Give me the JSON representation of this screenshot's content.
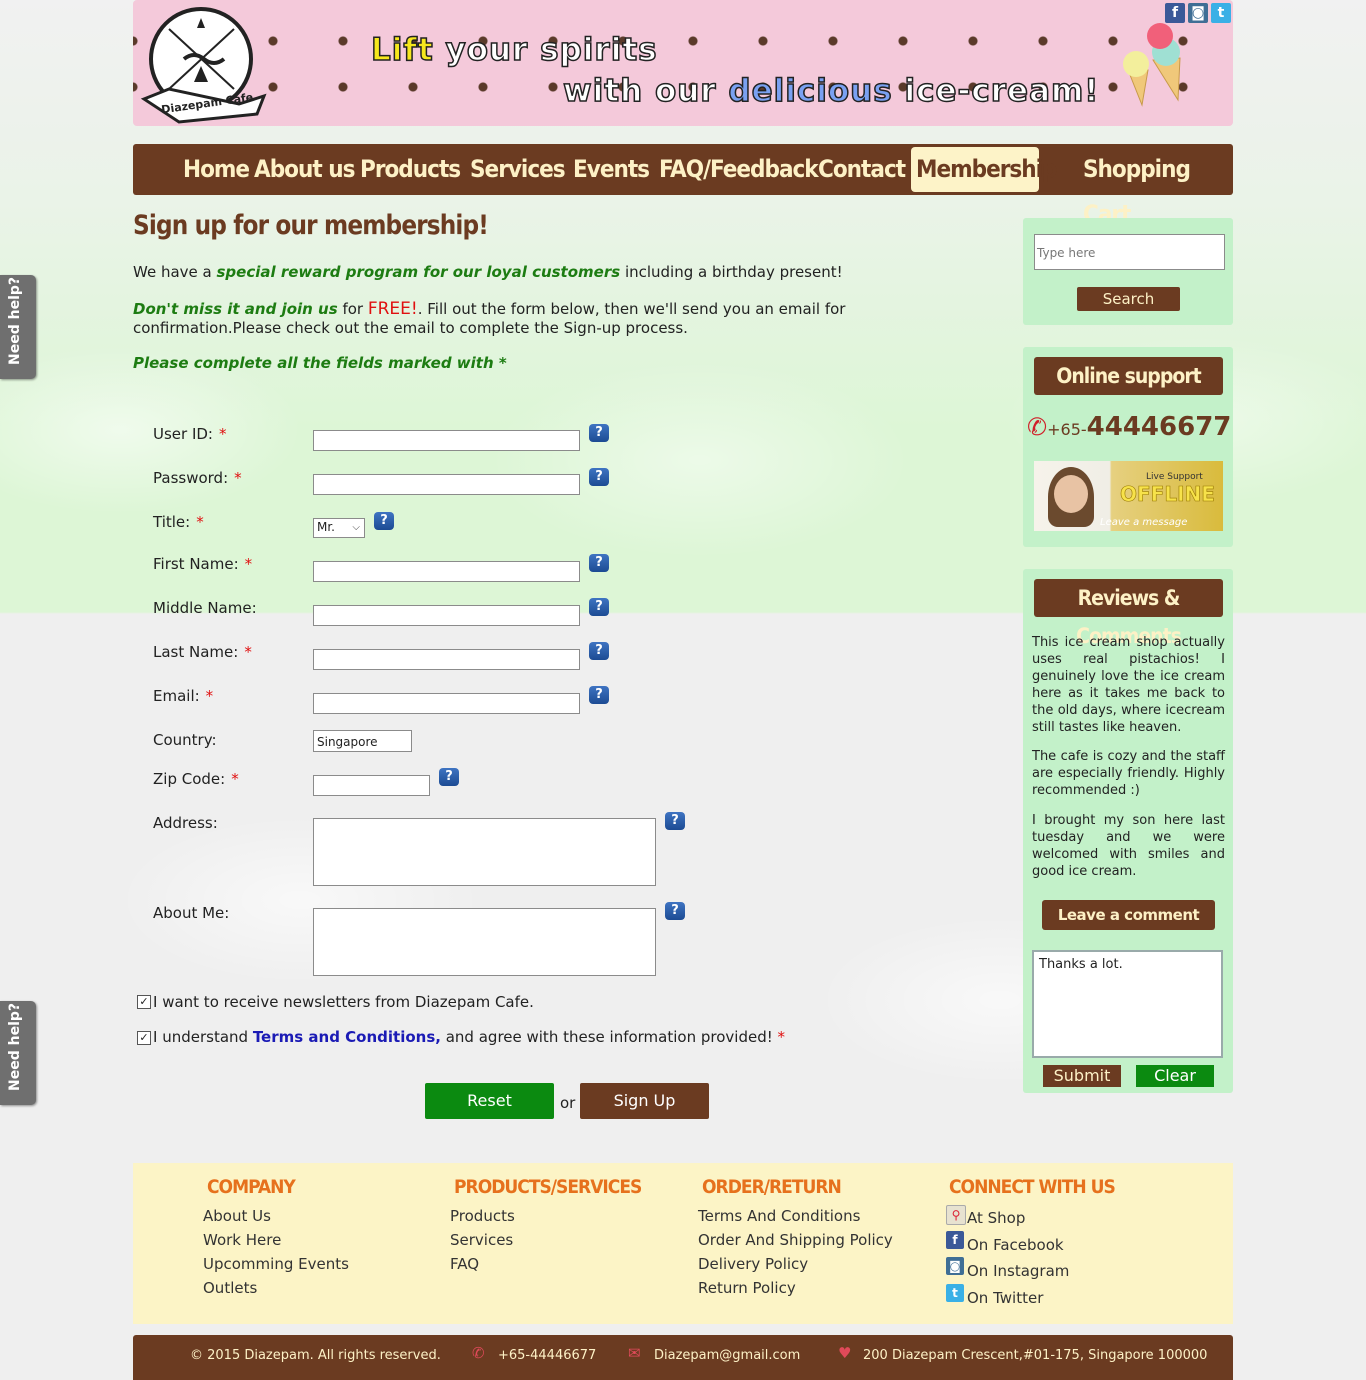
{
  "banner": {
    "logo_text": "Diazepam Cafe",
    "tagline_line1_a": "Lift",
    "tagline_line1_b": " your spirits",
    "tagline_line2_a": "with our ",
    "tagline_line2_b": "delicious",
    "tagline_line2_c": " ice-cream!",
    "social_icons": [
      "facebook-icon",
      "instagram-icon",
      "twitter-icon"
    ]
  },
  "nav": {
    "items": [
      "Home",
      "About us",
      "Products",
      "Services",
      "Events",
      "FAQ/Feedback",
      "Contact",
      "Membership",
      "Shopping Cart"
    ],
    "active": "Membership"
  },
  "main": {
    "title": "Sign up for our membership!",
    "intro1_a": "We have a ",
    "intro1_b": "special reward program for our loyal customers",
    "intro1_c": " including a birthday present!",
    "intro2_a": "Don't miss it and join us",
    "intro2_b": " for ",
    "intro2_c": "FREE!",
    "intro2_d": ". Fill out the form below, then we'll send you an email for confirmation.Please check out the email to complete the Sign-up process.",
    "required_note": "Please complete all the fields marked with *"
  },
  "form": {
    "user_id_label": "User ID:",
    "password_label": "Password:",
    "title_label": "Title:",
    "title_value": "Mr.",
    "first_name_label": "First Name:",
    "middle_name_label": "Middle Name:",
    "last_name_label": "Last Name:",
    "email_label": "Email:",
    "country_label": "Country:",
    "country_value": "Singapore",
    "zip_label": "Zip Code:",
    "address_label": "Address:",
    "about_label": "About Me:",
    "required_mark": "*",
    "help_mark": "?",
    "newsletter_text": "I want to receive newsletters from Diazepam Cafe.",
    "newsletter_checked": true,
    "terms_text_a": "I understand ",
    "terms_link": "Terms and Conditions,",
    "terms_text_b": " and agree with these information provided!",
    "terms_checked": true,
    "reset_label": "Reset",
    "or_text": "or",
    "signup_label": "Sign Up"
  },
  "sidebar": {
    "search_placeholder": "Type here",
    "search_button": "Search",
    "support_heading": "Online support",
    "phone_prefix": "+65-",
    "phone_number": "44446677",
    "support_img_small": "Live Support",
    "support_img_status": "OFFLINE",
    "support_img_leave": "Leave a message",
    "reviews_heading": "Reviews & Comments",
    "reviews": [
      "This ice cream shop actually uses real pistachios! I genuinely love the ice cream here as it takes me back to the old days, where icecream still tastes like heaven.",
      "The cafe is cozy and the staff are especially friendly. Highly recommended :)",
      "I brought my son here last tuesday and we were welcomed with smiles and good ice cream."
    ],
    "leave_comment": "Leave a comment",
    "comment_text": "Thanks a lot.",
    "submit": "Submit",
    "clear": "Clear"
  },
  "need_help": "Need help?",
  "footer": {
    "company_heading": "COMPANY",
    "company_links": [
      "About Us",
      "Work Here",
      "Upcomming Events",
      "Outlets"
    ],
    "products_heading": "PRODUCTS/SERVICES",
    "products_links": [
      "Products",
      "Services",
      "FAQ"
    ],
    "order_heading": "ORDER/RETURN",
    "order_links": [
      "Terms And Conditions",
      "Order And Shipping Policy",
      "Delivery Policy",
      "Return Policy"
    ],
    "connect_heading": "CONNECT WITH US",
    "connect_links": [
      "At Shop",
      "On Facebook",
      "On Instagram",
      "On Twitter"
    ],
    "copyright": "© 2015 Diazepam. All rights reserved.",
    "phone": "+65-44446677",
    "email": "Diazepam@gmail.com",
    "address": "200 Diazepam Crescent,#01-175, Singapore 100000"
  },
  "colors": {
    "brown": "#6b3b21",
    "cream": "#fdf1c6",
    "green_button": "#0b8a10",
    "sidebar_green": "#c3f1c9",
    "footer_heading_orange": "#e6711d",
    "banner_pink": "#f4c9da"
  }
}
